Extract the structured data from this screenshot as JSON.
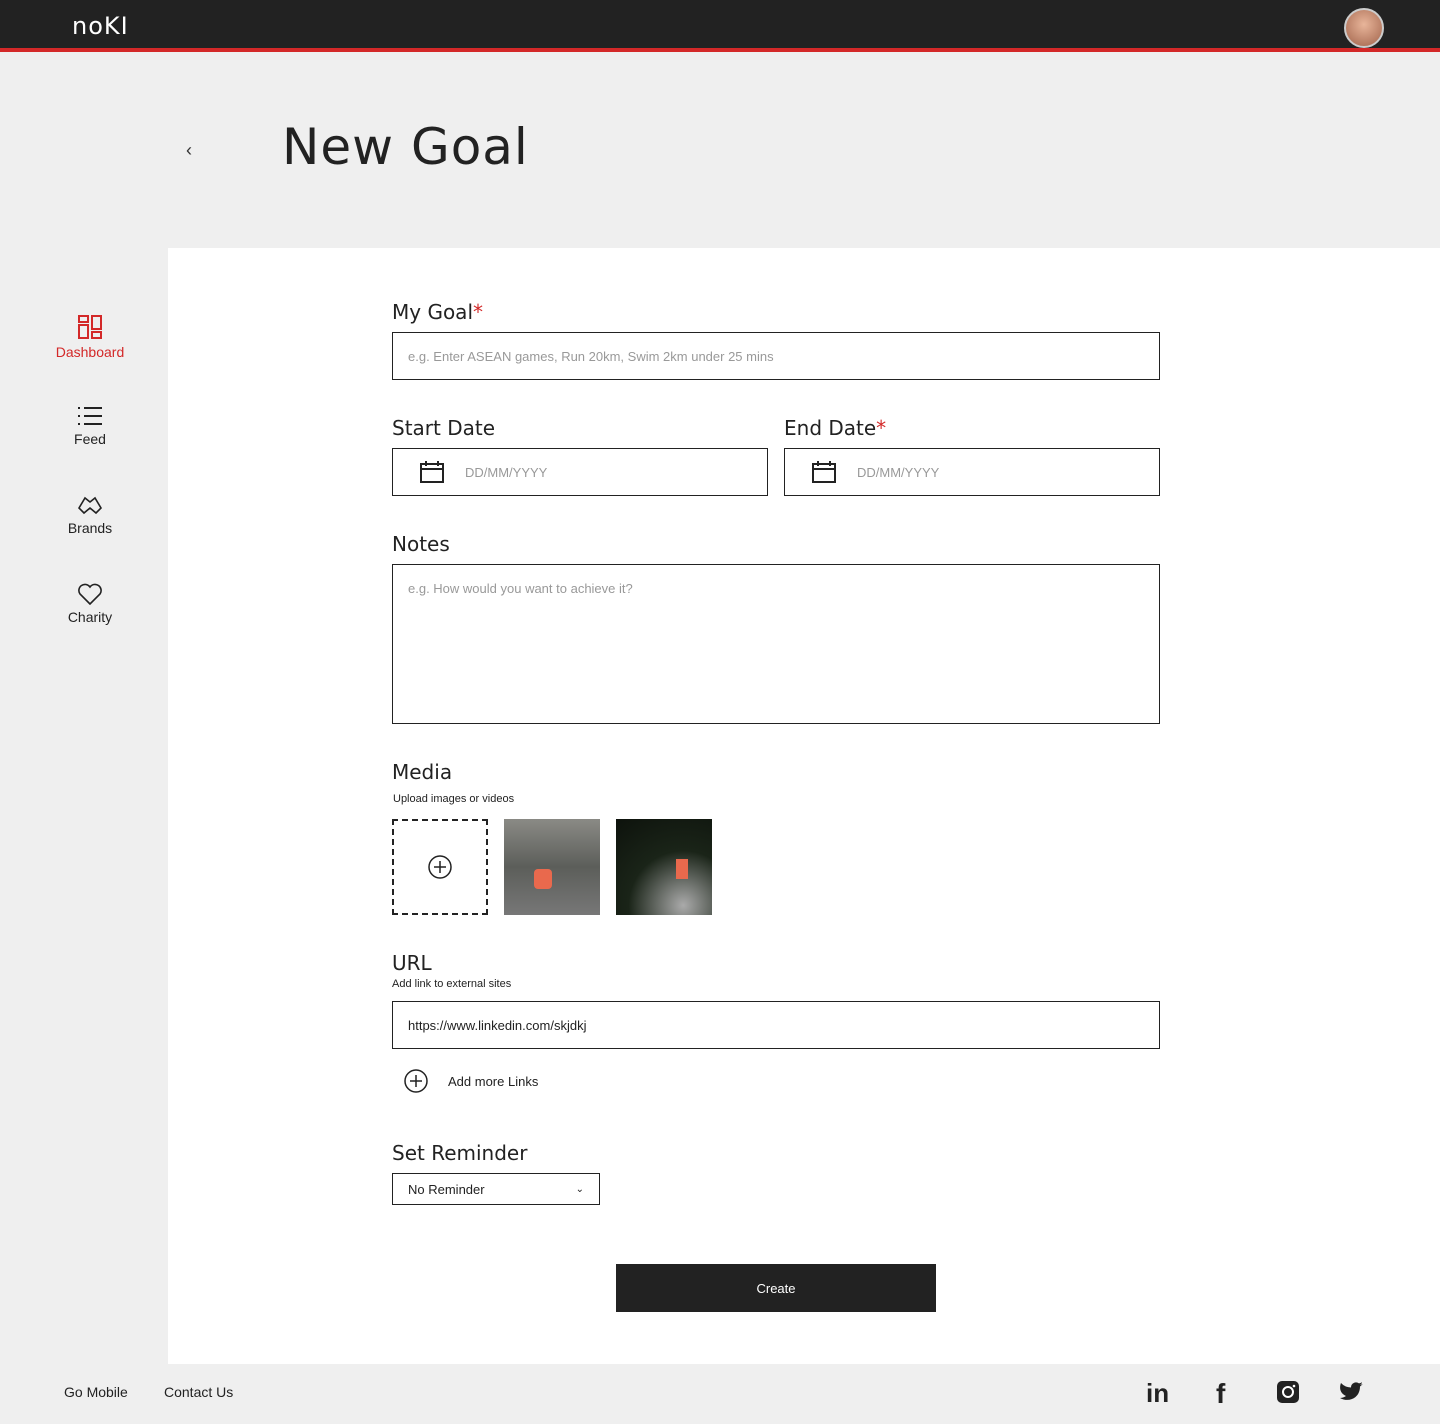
{
  "header": {
    "logo": "noKI"
  },
  "page": {
    "title": "New Goal"
  },
  "sidebar": {
    "items": [
      {
        "label": "Dashboard",
        "active": true
      },
      {
        "label": "Feed"
      },
      {
        "label": "Brands"
      },
      {
        "label": "Charity"
      }
    ]
  },
  "form": {
    "goal": {
      "label": "My Goal",
      "required": "*",
      "placeholder": "e.g. Enter ASEAN games, Run 20km, Swim 2km under 25 mins"
    },
    "start": {
      "label": "Start Date",
      "placeholder": "DD/MM/YYYY"
    },
    "end": {
      "label": "End Date",
      "required": "*",
      "placeholder": "DD/MM/YYYY"
    },
    "notes": {
      "label": "Notes",
      "placeholder": "e.g. How would you want to achieve it?"
    },
    "media": {
      "label": "Media",
      "sub": "Upload images or videos"
    },
    "url": {
      "label": "URL",
      "sub": "Add link to external sites",
      "value": "https://www.linkedin.com/skjdkj",
      "add": "Add more Links"
    },
    "reminder": {
      "label": "Set Reminder",
      "value": "No Reminder"
    },
    "create": "Create"
  },
  "footer": {
    "go_mobile": "Go Mobile",
    "contact": "Contact Us"
  },
  "colors": {
    "accent": "#d32828",
    "dark": "#222222"
  }
}
